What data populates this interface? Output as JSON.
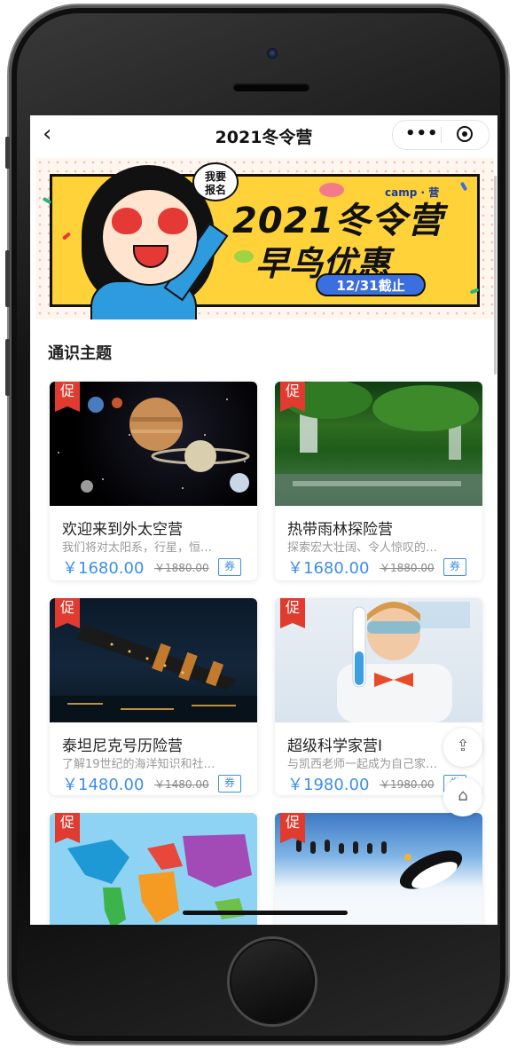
{
  "navbar": {
    "back_icon": "chevron-left-icon",
    "title": "2021冬令营",
    "menu_icon": "more-dots-icon",
    "target_icon": "record-target-icon"
  },
  "banner": {
    "badge": "我要\n报名",
    "logo": "camp · 营",
    "title": "2021冬令营",
    "subtitle": "早鸟优惠",
    "deadline": "12/31截止"
  },
  "section": {
    "title": "通识主题"
  },
  "cards": [
    {
      "tag": "促",
      "name": "欢迎来到外太空营",
      "desc": "我们将对太阳系，行星，恒…",
      "price": "￥1680.00",
      "old_price": "￥1880.00",
      "coupon": "券",
      "image": "solar-system"
    },
    {
      "tag": "促",
      "name": "热带雨林探险营",
      "desc": "探索宏大壮阔、令人惊叹的…",
      "price": "￥1680.00",
      "old_price": "￥1880.00",
      "coupon": "券",
      "image": "rainforest"
    },
    {
      "tag": "促",
      "name": "泰坦尼克号历险营",
      "desc": "了解19世纪的海洋知识和社…",
      "price": "￥1480.00",
      "old_price": "￥1480.00",
      "coupon": "券",
      "image": "titanic"
    },
    {
      "tag": "促",
      "name": "超级科学家营I",
      "desc": "与凯西老师一起成为自己家…",
      "price": "￥1980.00",
      "old_price": "￥1980.00",
      "coupon": "券",
      "image": "scientist-kid"
    },
    {
      "tag": "促",
      "image": "world-map"
    },
    {
      "tag": "促",
      "image": "penguins"
    }
  ],
  "floating": {
    "share_icon": "share-icon",
    "home_icon": "home-icon"
  }
}
